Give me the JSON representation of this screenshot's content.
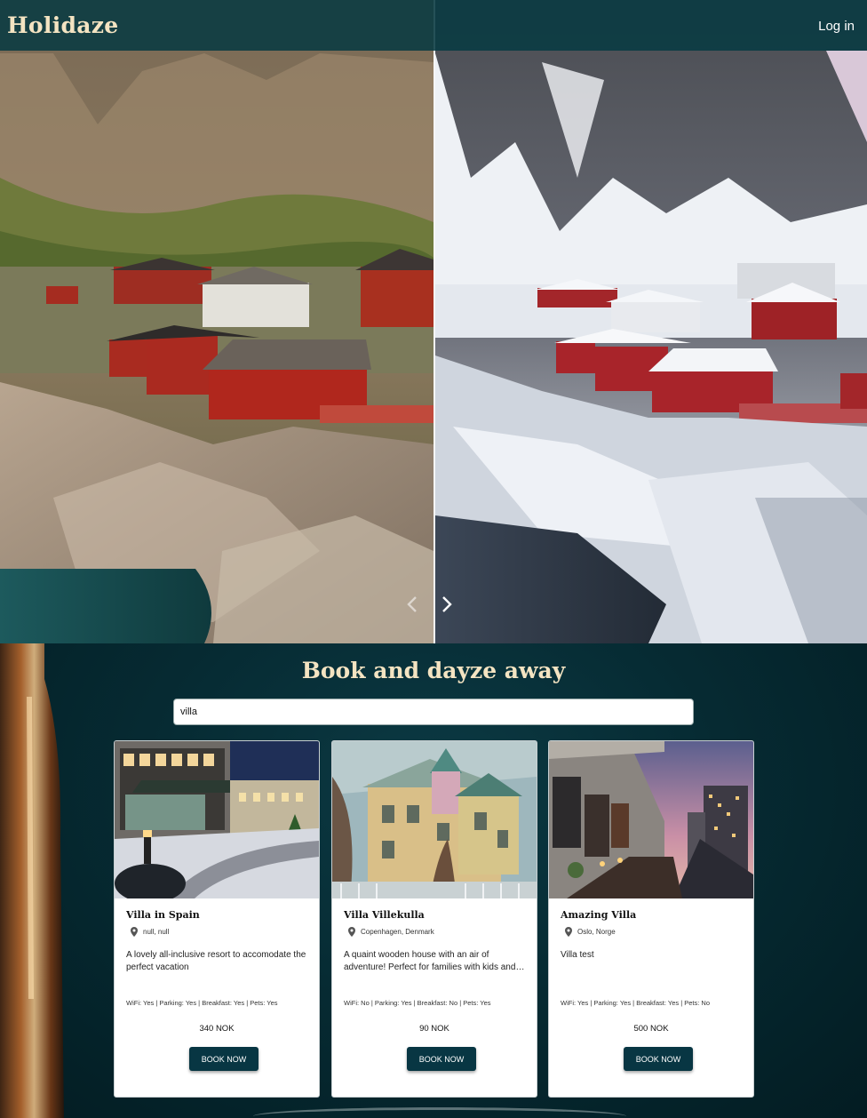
{
  "header": {
    "logo": "Holidaze",
    "login_label": "Log in"
  },
  "hero": {
    "prev_icon": "chevron-left-icon",
    "next_icon": "chevron-right-icon"
  },
  "main": {
    "title": "Book and dayze away",
    "search": {
      "value": "villa"
    }
  },
  "venues": [
    {
      "name": "Villa in Spain",
      "location": "null, null",
      "description": "A lovely all-inclusive resort to accomodate the perfect vacation",
      "amenities": "WiFi: Yes | Parking: Yes | Breakfast: Yes | Pets: Yes",
      "price": "340 NOK",
      "button": "BOOK NOW"
    },
    {
      "name": "Villa Villekulla",
      "location": "Copenhagen, Denmark",
      "description": "A quaint wooden house with an air of adventure! Perfect for families with kids and horses.",
      "amenities": "WiFi: No | Parking: Yes | Breakfast: No | Pets: Yes",
      "price": "90 NOK",
      "button": "BOOK NOW"
    },
    {
      "name": "Amazing Villa",
      "location": "Oslo, Norge",
      "description": "Villa test",
      "amenities": "WiFi: Yes | Parking: Yes | Breakfast: Yes | Pets: No",
      "price": "500 NOK",
      "button": "BOOK NOW"
    }
  ],
  "colors": {
    "header_bg": "#083a42",
    "logo": "#f4e4c2",
    "button_bg": "#083643",
    "page_bg": "#062a33"
  }
}
